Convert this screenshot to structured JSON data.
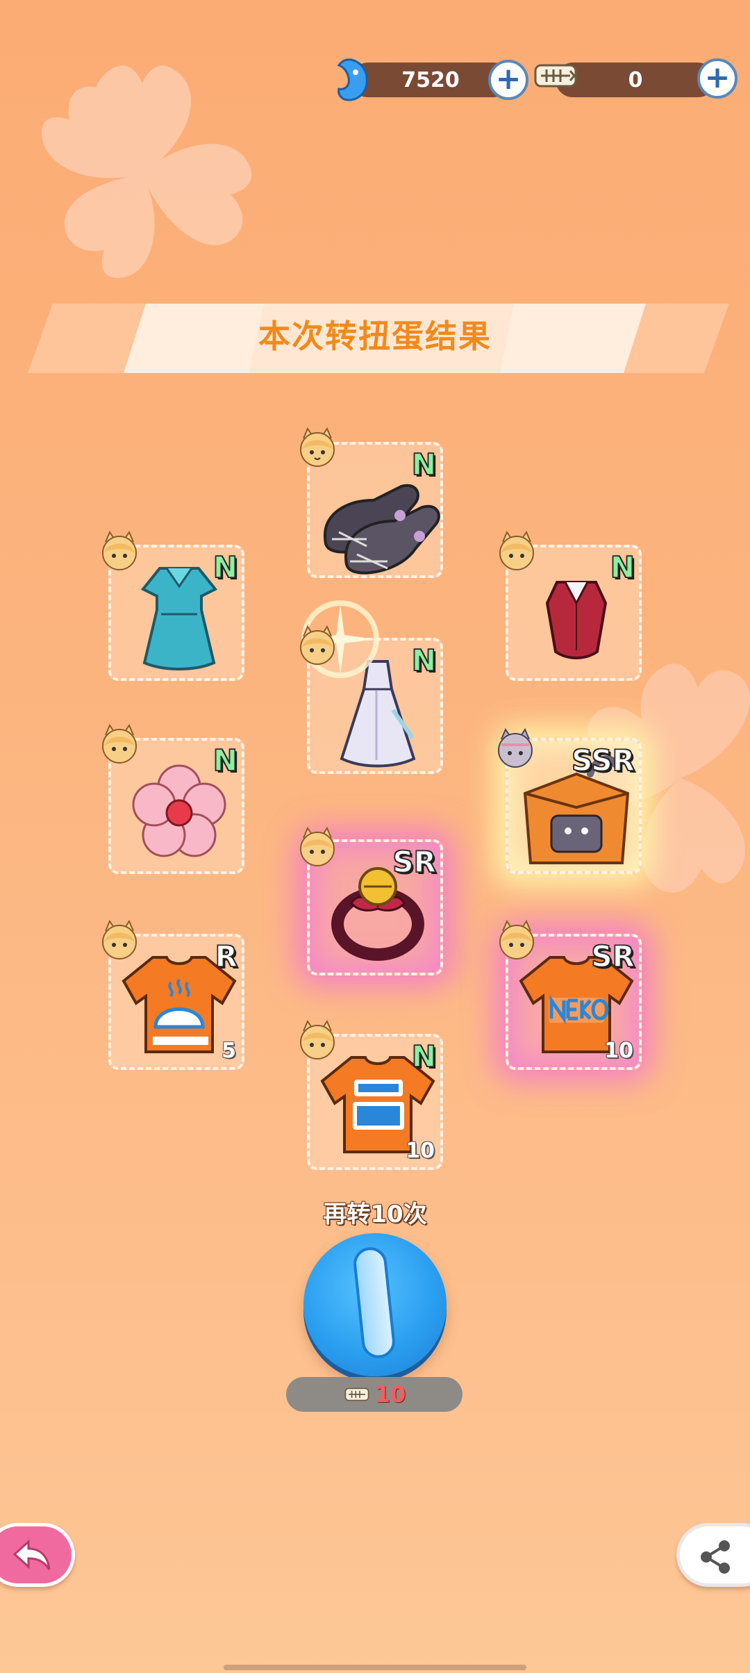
{
  "currency": {
    "gems": {
      "icon": "blue-gem-fish-icon",
      "value": "7520"
    },
    "fishbone": {
      "icon": "fishbone-ticket-icon",
      "value": "0"
    }
  },
  "banner": {
    "title": "本次转扭蛋结果"
  },
  "items": [
    {
      "id": "shoes",
      "rarity": "N",
      "icon": "lace-shoes-icon",
      "quantity": ""
    },
    {
      "id": "blue-dress",
      "rarity": "N",
      "icon": "blue-dress-icon",
      "quantity": ""
    },
    {
      "id": "red-top",
      "rarity": "N",
      "icon": "red-vest-icon",
      "quantity": ""
    },
    {
      "id": "gown",
      "rarity": "N",
      "icon": "white-gown-icon",
      "quantity": ""
    },
    {
      "id": "flower-pin",
      "rarity": "N",
      "icon": "pink-flower-icon",
      "quantity": ""
    },
    {
      "id": "cat-bed",
      "rarity": "SSR",
      "icon": "cat-house-icon",
      "quantity": ""
    },
    {
      "id": "ribbon-bell",
      "rarity": "SR",
      "icon": "bell-collar-icon",
      "quantity": ""
    },
    {
      "id": "tshirt-steam",
      "rarity": "R",
      "icon": "orange-tshirt-icon",
      "quantity": "5"
    },
    {
      "id": "tshirt-neko",
      "rarity": "SR",
      "icon": "neko-tshirt-icon",
      "quantity": "10"
    },
    {
      "id": "tshirt-text",
      "rarity": "N",
      "icon": "text-tshirt-icon",
      "quantity": "10"
    }
  ],
  "spin": {
    "label": "再转10次",
    "cost": "10"
  },
  "colors": {
    "background": "#fcb47e",
    "title": "#f08a1c",
    "spin_button": "#2b9ff0",
    "back_button": "#f06aa0",
    "rarity_n": "#8cf0a0"
  }
}
